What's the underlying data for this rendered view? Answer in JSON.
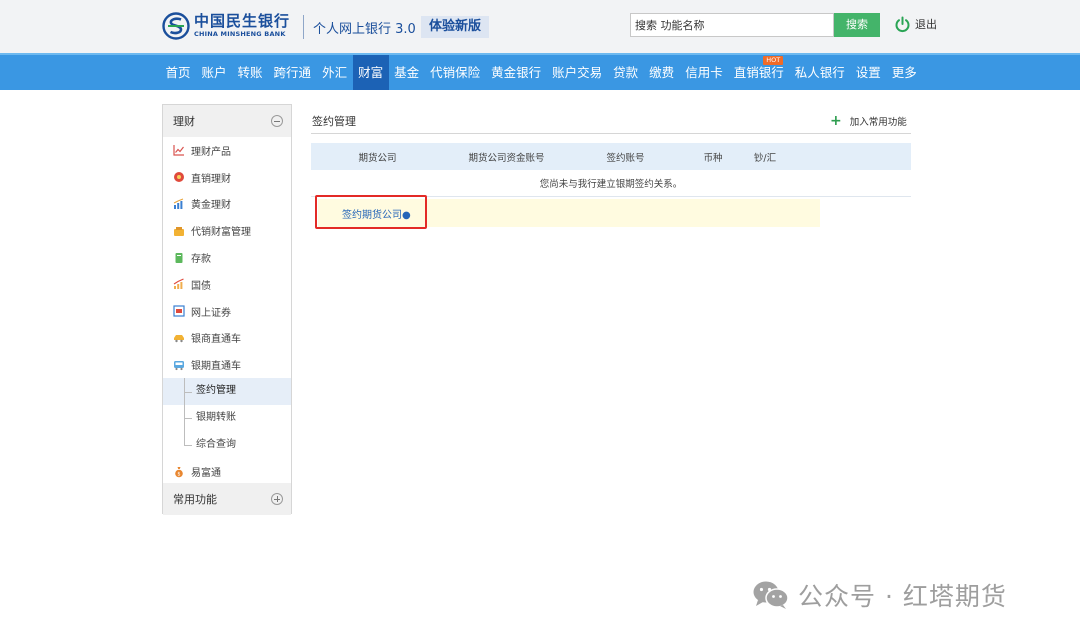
{
  "header": {
    "bank_name": "中国民生银行",
    "bank_name_en": "CHINA MINSHENG BANK",
    "product_name": "个人网上银行 3.0",
    "new_version_label": "体验新版",
    "search_value": "搜索 功能名称",
    "search_button": "搜索",
    "logout_label": "退出",
    "colors": {
      "brand_blue": "#1b4f9c",
      "search_green": "#44b46a",
      "logout_green": "#2aa455"
    }
  },
  "nav": {
    "items": [
      {
        "label": "首页"
      },
      {
        "label": "账户"
      },
      {
        "label": "转账"
      },
      {
        "label": "跨行通"
      },
      {
        "label": "外汇"
      },
      {
        "label": "财富",
        "active": true
      },
      {
        "label": "基金"
      },
      {
        "label": "代销保险"
      },
      {
        "label": "黄金银行"
      },
      {
        "label": "账户交易"
      },
      {
        "label": "贷款"
      },
      {
        "label": "缴费"
      },
      {
        "label": "信用卡"
      },
      {
        "label": "直销银行",
        "badge": "HOT"
      },
      {
        "label": "私人银行"
      },
      {
        "label": "设置"
      },
      {
        "label": "更多"
      }
    ],
    "colors": {
      "bar": "#3a97e3",
      "active": "#1c62b5",
      "hot": "#f06b28"
    }
  },
  "sidebar": {
    "section_title": "理财",
    "items": [
      {
        "label": "理财产品",
        "icon": "line-chart-icon"
      },
      {
        "label": "直销理财",
        "icon": "flower-icon"
      },
      {
        "label": "黄金理财",
        "icon": "bar-chart-icon"
      },
      {
        "label": "代销财富管理",
        "icon": "coins-icon"
      },
      {
        "label": "存款",
        "icon": "passbook-icon"
      },
      {
        "label": "国债",
        "icon": "growth-chart-icon"
      },
      {
        "label": "网上证券",
        "icon": "monitor-icon"
      },
      {
        "label": "银商直通车",
        "icon": "car-icon"
      },
      {
        "label": "银期直通车",
        "icon": "bus-icon"
      }
    ],
    "sub_items": [
      {
        "label": "签约管理",
        "active": true
      },
      {
        "label": "银期转账"
      },
      {
        "label": "综合查询"
      }
    ],
    "after_item": {
      "label": "易富通",
      "icon": "money-bag-icon"
    },
    "favorites_title": "常用功能"
  },
  "main": {
    "title": "签约管理",
    "add_favorite": "加入常用功能",
    "table": {
      "columns": [
        "期货公司",
        "期货公司资金账号",
        "签约账号",
        "币种",
        "钞/汇"
      ],
      "empty_message": "您尚未与我行建立银期签约关系。"
    },
    "signup_link": "签约期货公司",
    "signup_dot": "●",
    "colors": {
      "highlight": "#e32a26",
      "link": "#2566b8",
      "header_bg": "#e3eef9"
    }
  },
  "watermark": {
    "text": "公众号 · 红塔期货"
  }
}
